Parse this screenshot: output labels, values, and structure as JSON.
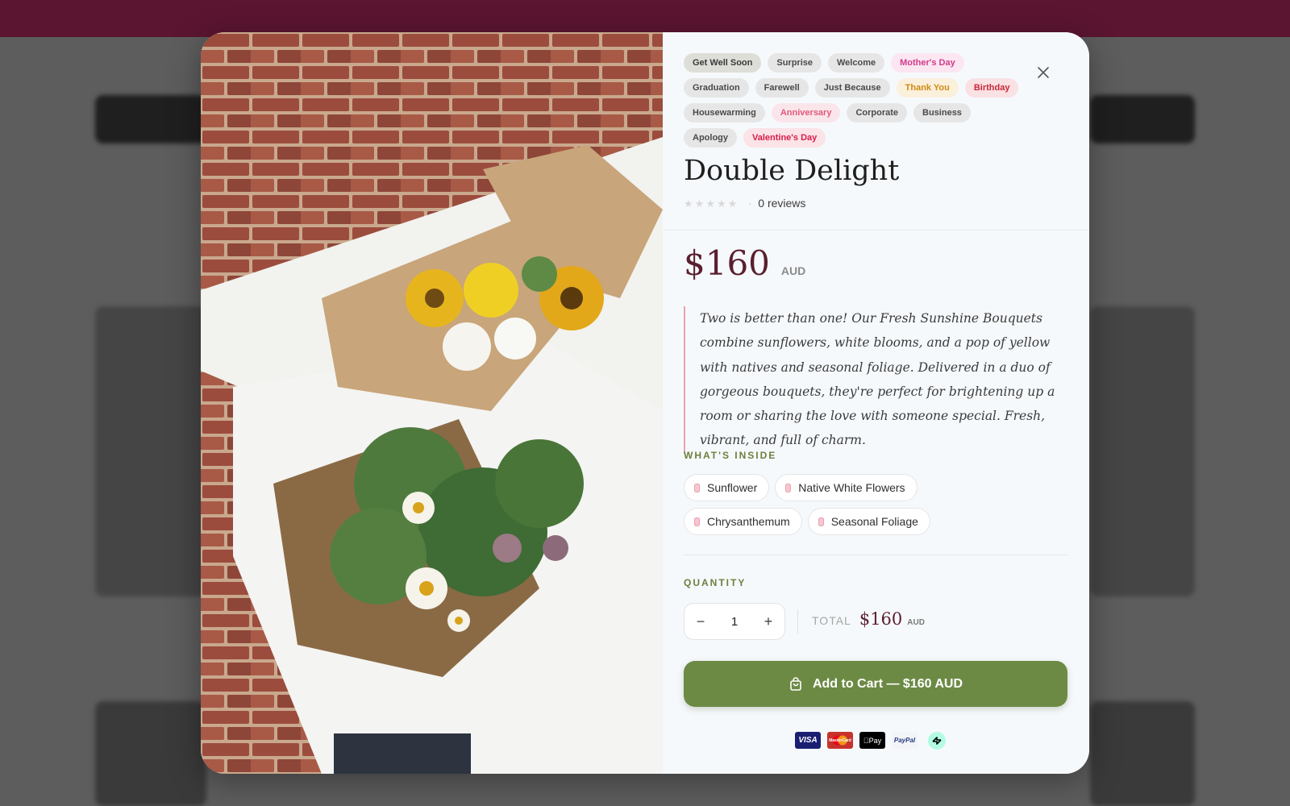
{
  "tags": [
    {
      "label": "Get Well Soon",
      "style": "active"
    },
    {
      "label": "Surprise",
      "style": "default"
    },
    {
      "label": "Welcome",
      "style": "default"
    },
    {
      "label": "Mother's Day",
      "style": "pink"
    },
    {
      "label": "Graduation",
      "style": "default"
    },
    {
      "label": "Farewell",
      "style": "default"
    },
    {
      "label": "Just Because",
      "style": "default"
    },
    {
      "label": "Thank You",
      "style": "amber"
    },
    {
      "label": "Birthday",
      "style": "red"
    },
    {
      "label": "Housewarming",
      "style": "default"
    },
    {
      "label": "Anniversary",
      "style": "rose"
    },
    {
      "label": "Corporate",
      "style": "default"
    },
    {
      "label": "Business",
      "style": "default"
    },
    {
      "label": "Apology",
      "style": "default"
    },
    {
      "label": "Valentine's Day",
      "style": "crimson"
    }
  ],
  "product": {
    "title": "Double Delight",
    "rating": 0,
    "reviews_label": "0 reviews",
    "price": "$160",
    "currency": "AUD",
    "description": "Two is better than one! Our Fresh Sunshine Bouquets combine sunflowers, white blooms, and a pop of yellow with natives and seasonal foliage. Delivered in a duo of gorgeous bouquets, they're perfect for brightening up a room or sharing the love with someone special. Fresh, vibrant, and full of charm."
  },
  "whats_inside": {
    "label": "WHAT'S INSIDE",
    "items": [
      "Sunflower",
      "Native White Flowers",
      "Chrysanthemum",
      "Seasonal Foliage"
    ]
  },
  "quantity": {
    "label": "QUANTITY",
    "value": "1",
    "decrement": "−",
    "increment": "+"
  },
  "total": {
    "label": "TOTAL",
    "price": "$160",
    "currency": "AUD"
  },
  "cart_button": {
    "label": "Add to Cart — $160 AUD"
  },
  "payments": {
    "visa": "VISA",
    "mastercard": "MasterCard",
    "apple_pay": "Pay",
    "paypal": "PayPal",
    "afterpay_icon": "afterpay-icon"
  },
  "colors": {
    "accent_green": "#6c8a44",
    "price_burgundy": "#5a1f2e",
    "label_olive": "#6d7f3c",
    "quote_border": "#e8a3ae",
    "header_band": "#5b1530"
  }
}
